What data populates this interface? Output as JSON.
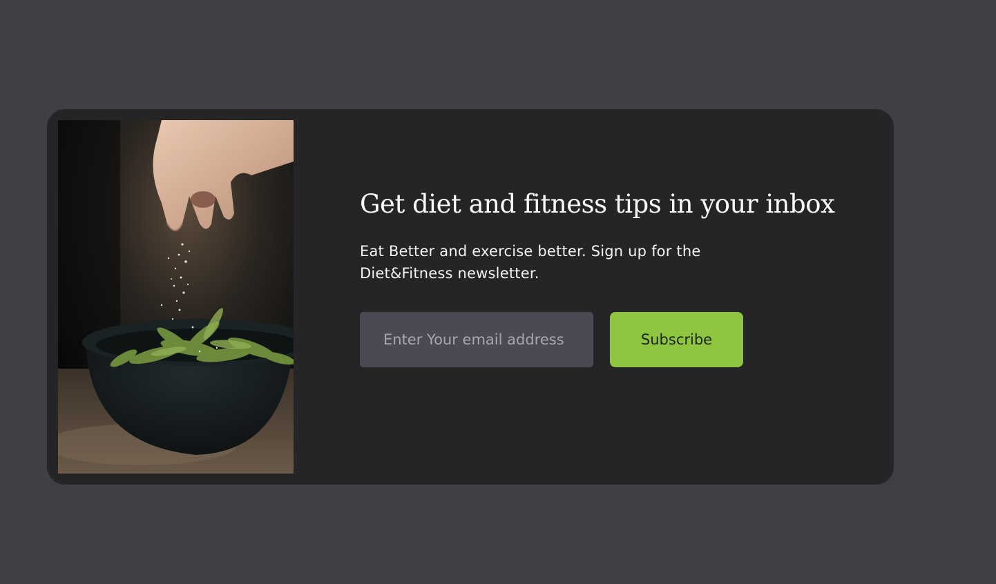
{
  "newsletter": {
    "title": "Get diet and fitness tips in your inbox",
    "description": "Eat Better and exercise better. Sign up for the Diet&Fitness newsletter.",
    "email_placeholder": "Enter Your email address",
    "email_value": "",
    "subscribe_label": "Subscribe",
    "image": "food-seasoning-photo"
  },
  "colors": {
    "page_background": "#403f45",
    "card_background": "#252528",
    "input_background": "#4b4a52",
    "accent": "#8fc63f"
  }
}
